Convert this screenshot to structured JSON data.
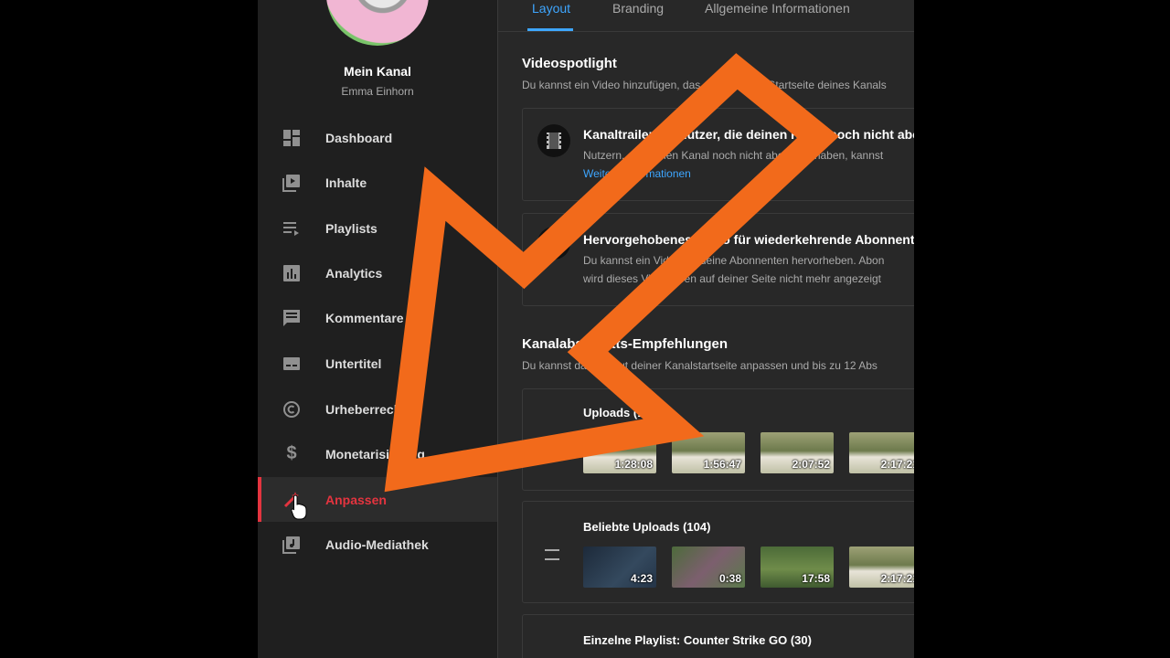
{
  "channel": {
    "title": "Mein Kanal",
    "name": "Emma Einhorn"
  },
  "nav": [
    {
      "label": "Dashboard",
      "icon": "dashboard-icon"
    },
    {
      "label": "Inhalte",
      "icon": "content-icon"
    },
    {
      "label": "Playlists",
      "icon": "playlist-icon"
    },
    {
      "label": "Analytics",
      "icon": "analytics-icon"
    },
    {
      "label": "Kommentare",
      "icon": "comment-icon"
    },
    {
      "label": "Untertitel",
      "icon": "subtitles-icon"
    },
    {
      "label": "Urheberrecht",
      "icon": "copyright-icon"
    },
    {
      "label": "Monetarisierung",
      "icon": "dollar-icon"
    },
    {
      "label": "Anpassen",
      "icon": "magic-wand-icon",
      "active": true
    },
    {
      "label": "Audio-Mediathek",
      "icon": "audio-library-icon"
    }
  ],
  "tabs": [
    "Layout",
    "Branding",
    "Allgemeine Informationen"
  ],
  "spotlight": {
    "title": "Videospotlight",
    "desc": "Du kannst ein Video hinzufügen, das oben auf der Startseite deines Kanals",
    "trailer": {
      "title": "Kanaltrailer für Nutzer, die deinen Kanal noch nicht abonniert haben",
      "text": "Nutzern, die deinen Kanal noch nicht abonniert haben, kannst",
      "link": "Weitere Informationen"
    },
    "featured": {
      "title": "Hervorgehobenes Video für wiederkehrende Abonnenten",
      "text1": "Du kannst ein Video für deine Abonnenten hervorheben. Abon",
      "text2": "wird dieses Video oben auf deiner Seite nicht mehr angezeigt"
    }
  },
  "sections": {
    "title": "Kanalabschnitts-Empfehlungen",
    "desc": "Du kannst das Layout deiner Kanalstartseite anpassen und bis zu 12 Abs",
    "uploads": {
      "title": "Uploads (1",
      "durations": [
        "1:28:08",
        "1:56:47",
        "2:07:52",
        "2:17:21"
      ]
    },
    "popular": {
      "title": "Beliebte Uploads (104)",
      "durations": [
        "4:23",
        "0:38",
        "17:58",
        "2:17:21"
      ]
    },
    "playlist": {
      "title": "Einzelne Playlist: Counter Strike GO (30)"
    }
  },
  "overlay": {
    "arrow_color": "#f26a1b"
  }
}
